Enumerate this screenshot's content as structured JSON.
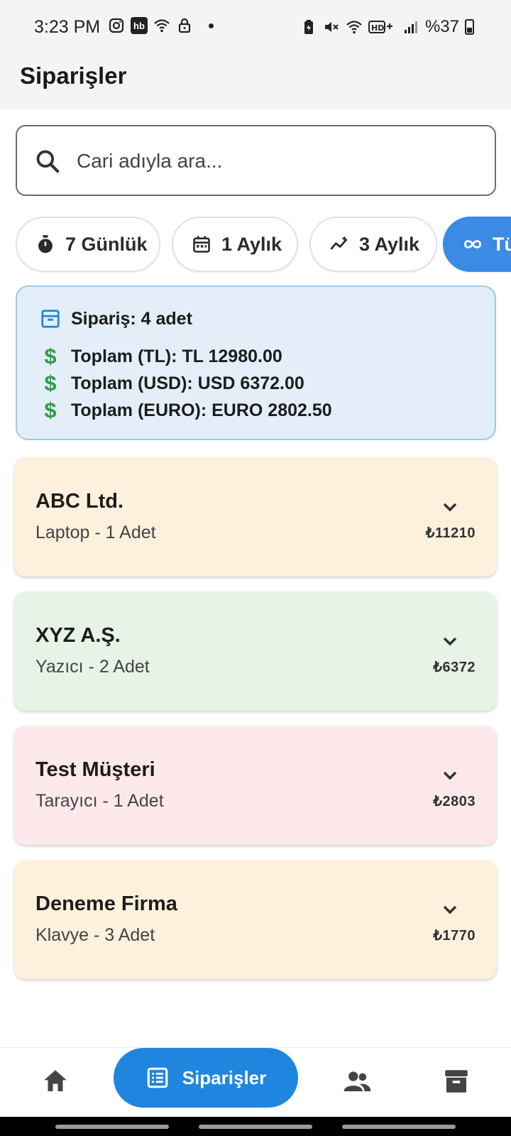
{
  "status_bar": {
    "time": "3:23 PM",
    "hb_badge": "hb",
    "battery": "%37",
    "left_icons": [
      "instagram-icon",
      "hb-icon",
      "wifi-icon",
      "lock-icon"
    ],
    "right_icons": [
      "battery-saver-icon",
      "mute-icon",
      "wifi-icon",
      "hd-icon",
      "signal-icon"
    ]
  },
  "header": {
    "title": "Siparişler"
  },
  "search": {
    "placeholder": "Cari adıyla ara..."
  },
  "filters": [
    {
      "label": "7 Günlük",
      "icon": "timer-icon"
    },
    {
      "label": "1 Aylık",
      "icon": "calendar-icon"
    },
    {
      "label": "3 Aylık",
      "icon": "trend-icon"
    },
    {
      "label": "Tümü",
      "icon": "infinity-icon",
      "active": true
    }
  ],
  "summary": {
    "count": "Sipariş: 4 adet",
    "total_tl": "Toplam (TL): TL 12980.00",
    "total_usd": "Toplam (USD): USD 6372.00",
    "total_euro": "Toplam (EURO): EURO 2802.50"
  },
  "orders": [
    {
      "name": "ABC Ltd.",
      "detail": "Laptop - 1 Adet",
      "price": "₺11210",
      "color": "#fdf0dd"
    },
    {
      "name": "XYZ A.Ş.",
      "detail": "Yazıcı - 2 Adet",
      "price": "₺6372",
      "color": "#e6f3e6"
    },
    {
      "name": "Test Müşteri",
      "detail": "Tarayıcı - 1 Adet",
      "price": "₺2803",
      "color": "#fde8ec"
    },
    {
      "name": "Deneme Firma",
      "detail": "Klavye - 3 Adet",
      "price": "₺1770",
      "color": "#fdf0dd"
    }
  ],
  "bottom_nav": {
    "active_label": "Siparişler",
    "items": [
      "home-icon",
      "orders-icon",
      "customers-icon",
      "products-icon"
    ]
  },
  "colors": {
    "accent": "#1f86e0",
    "chip_active": "#3b8be6",
    "summary_bg": "#e3eef9",
    "dollar": "#2e9e47"
  }
}
